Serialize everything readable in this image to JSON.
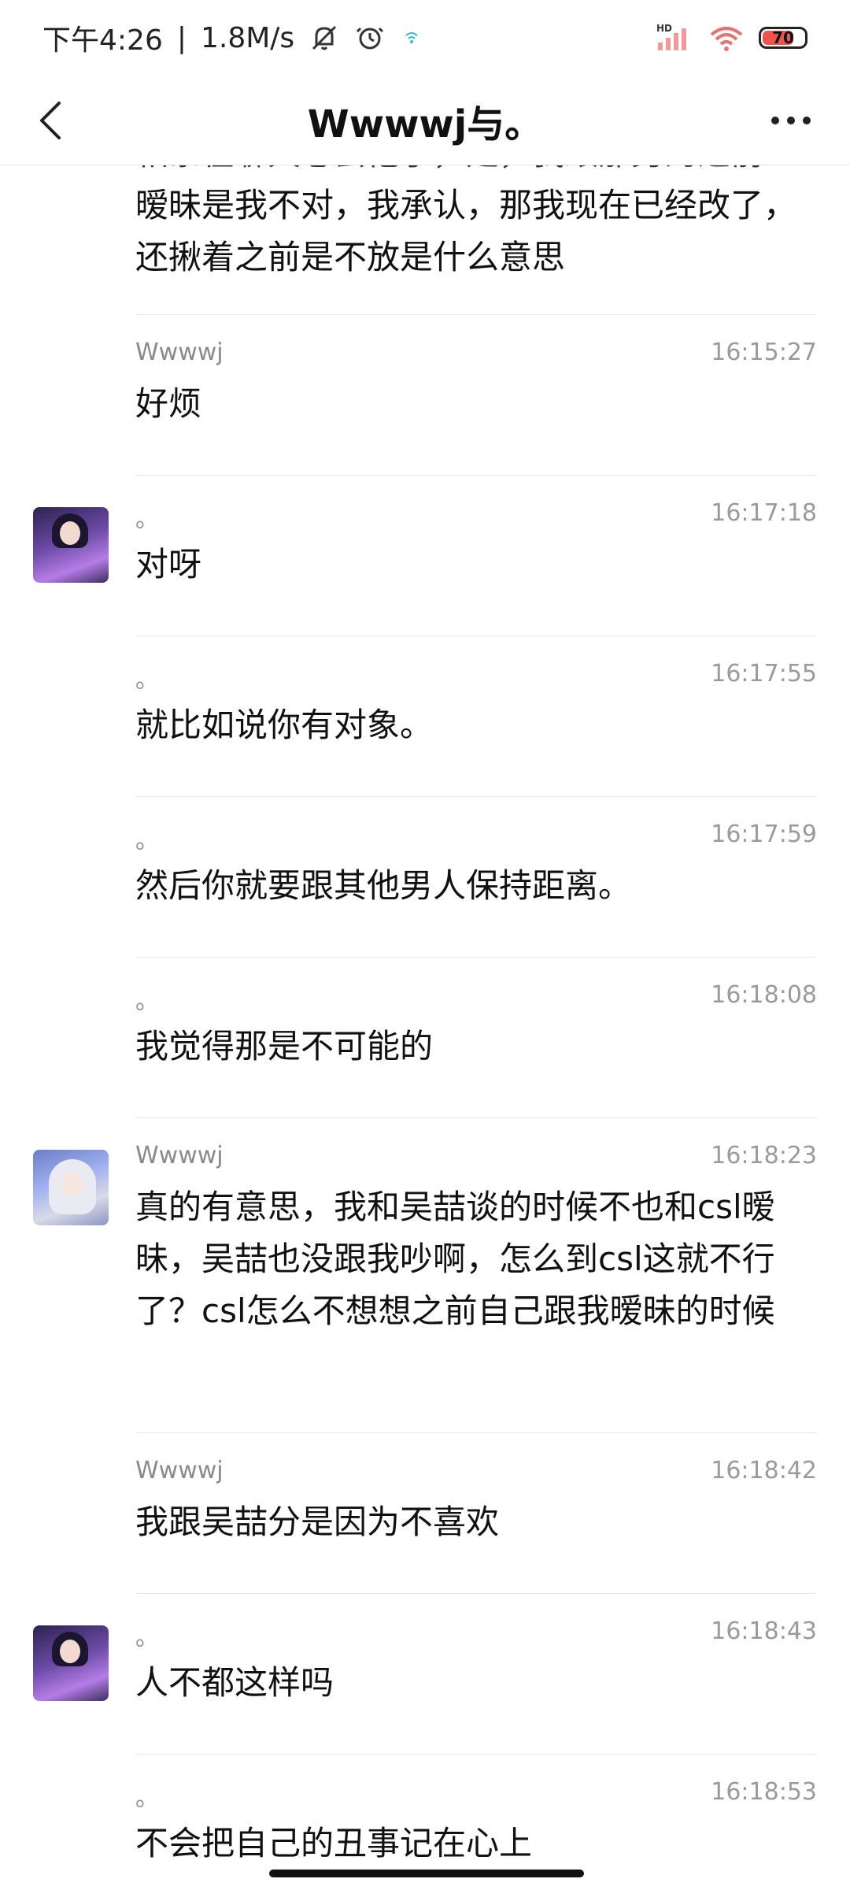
{
  "status_bar": {
    "time": "下午4:26",
    "separator": "|",
    "speed": "1.8M/s",
    "battery": "70",
    "signal_label": "HD"
  },
  "header": {
    "title": "Wwwwj与。"
  },
  "messages": [
    {
      "sender": "",
      "time": "",
      "text": "暧昧是我不对，我承认，那我现在已经改了，还揪着之前是不放是什么意思",
      "avatar": null,
      "partial_top": true
    },
    {
      "sender": "Wwwwj",
      "time": "16:15:27",
      "text": "好烦",
      "avatar": null
    },
    {
      "sender": "。",
      "time": "16:17:18",
      "text": "对呀",
      "avatar": "avatar-a"
    },
    {
      "sender": "。",
      "time": "16:17:55",
      "text": "就比如说你有对象。",
      "avatar": null
    },
    {
      "sender": "。",
      "time": "16:17:59",
      "text": "然后你就要跟其他男人保持距离。",
      "avatar": null
    },
    {
      "sender": "。",
      "time": "16:18:08",
      "text": "我觉得那是不可能的",
      "avatar": null
    },
    {
      "sender": "Wwwwj",
      "time": "16:18:23",
      "text": "真的有意思，我和吴喆谈的时候不也和csl暧昧，吴喆也没跟我吵啊，怎么到csl这就不行了？csl怎么不想想之前自己跟我暧昧的时候",
      "avatar": "avatar-b"
    },
    {
      "sender": "Wwwwj",
      "time": "16:18:42",
      "text": "我跟吴喆分是因为不喜欢",
      "avatar": null
    },
    {
      "sender": "。",
      "time": "16:18:43",
      "text": "人不都这样吗",
      "avatar": "avatar-a"
    },
    {
      "sender": "。",
      "time": "16:18:53",
      "text": "不会把自己的丑事记在心上",
      "avatar": null,
      "partial_bottom": true
    }
  ]
}
